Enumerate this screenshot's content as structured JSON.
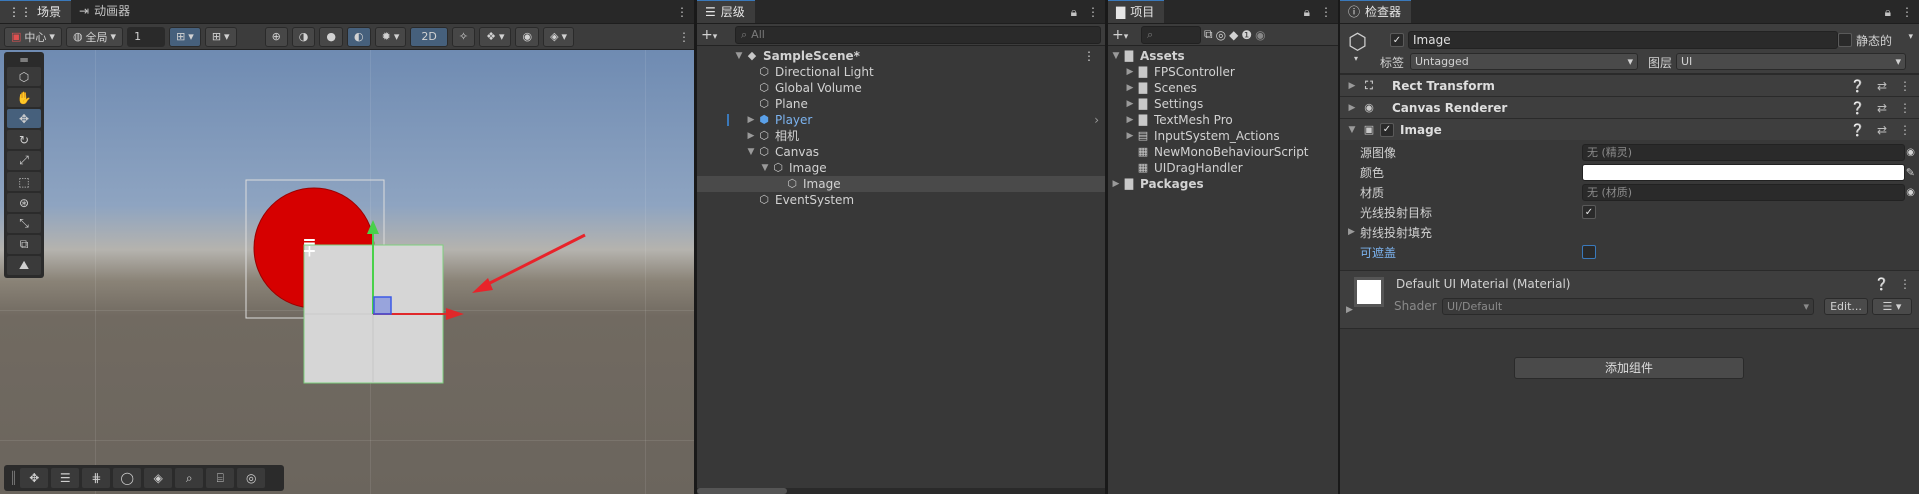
{
  "scene": {
    "tabs": [
      "场景",
      "动画器"
    ],
    "pivot_label": "中心",
    "space_label": "全局",
    "snap_value": "1",
    "mode_2d": "2D"
  },
  "hierarchy": {
    "tab": "层级",
    "search_placeholder": "All",
    "items": [
      {
        "label": "SampleScene*",
        "depth": 0
      },
      {
        "label": "Directional Light",
        "depth": 1
      },
      {
        "label": "Global Volume",
        "depth": 1
      },
      {
        "label": "Plane",
        "depth": 1
      },
      {
        "label": "Player",
        "depth": 1
      },
      {
        "label": "相机",
        "depth": 1
      },
      {
        "label": "Canvas",
        "depth": 1
      },
      {
        "label": "Image",
        "depth": 2
      },
      {
        "label": "Image",
        "depth": 3
      },
      {
        "label": "EventSystem",
        "depth": 1
      }
    ]
  },
  "project": {
    "tab": "项目",
    "root": "Assets",
    "items": [
      "FPSController",
      "Scenes",
      "Settings",
      "TextMesh Pro",
      "InputSystem_Actions",
      "NewMonoBehaviourScript",
      "UIDragHandler"
    ],
    "packages": "Packages"
  },
  "inspector": {
    "tab": "检查器",
    "object_name": "Image",
    "static_label": "静态的",
    "tag_label": "标签",
    "tag_value": "Untagged",
    "layer_label": "图层",
    "layer_value": "UI",
    "components": [
      "Rect Transform",
      "Canvas Renderer",
      "Image"
    ],
    "props": {
      "source_image": "源图像",
      "source_image_value": "无 (精灵)",
      "color": "颜色",
      "material": "材质",
      "material_value": "无 (材质)",
      "raycast_target": "光线投射目标",
      "raycast_padding": "射线投射填充",
      "maskable": "可遮盖"
    },
    "material_name": "Default UI Material (Material)",
    "shader_label": "Shader",
    "shader_value": "UI/Default",
    "edit_label": "Edit...",
    "add_component": "添加组件"
  },
  "colors": {
    "accent": "#3a79bb",
    "player_blue": "#5aa0e8",
    "circle_red": "#d60000",
    "arrow_red": "#e8232a"
  }
}
